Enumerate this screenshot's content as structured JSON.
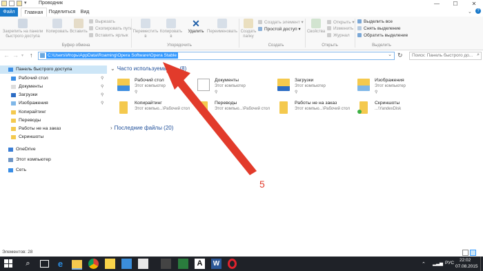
{
  "window": {
    "title": "Проводник"
  },
  "tabs": [
    "Файл",
    "Главная",
    "Поделиться",
    "Вид"
  ],
  "ribbon": {
    "clipboard": {
      "pin_label": "Закрепить на панели быстрого доступа",
      "copy_label": "Копировать",
      "paste_label": "Вставить",
      "cut": "Вырезать",
      "copy_path": "Скопировать путь",
      "paste_shortcut": "Вставить ярлык",
      "group_label": "Буфер обмена"
    },
    "organize": {
      "move_label": "Переместить в",
      "copy_to_label": "Копировать в",
      "delete_label": "Удалить",
      "rename_label": "Переименовать",
      "group_label": "Упорядочить"
    },
    "create": {
      "new_folder_label": "Создать папку",
      "new_item": "Создать элемент",
      "easy_access": "Простой доступ",
      "group_label": "Создать"
    },
    "open": {
      "properties_label": "Свойства",
      "open": "Открыть",
      "edit": "Изменить",
      "history": "Журнал",
      "group_label": "Открыть"
    },
    "select": {
      "select_all": "Выделить все",
      "select_none": "Снять выделение",
      "invert": "Обратить выделение",
      "group_label": "Выделить"
    }
  },
  "address": {
    "path": "C:\\Users\\Игорь\\AppData\\Roaming\\Opera Software\\Opera Stable",
    "search_placeholder": "Поиск: Панель быстрого до..."
  },
  "sidebar": {
    "items": [
      {
        "label": "Панель быстрого доступа",
        "pinned": false
      },
      {
        "label": "Рабочий стол",
        "pinned": true
      },
      {
        "label": "Документы",
        "pinned": true
      },
      {
        "label": "Загрузки",
        "pinned": true
      },
      {
        "label": "Изображения",
        "pinned": true
      },
      {
        "label": "Копирайтинг",
        "pinned": false
      },
      {
        "label": "Переводы",
        "pinned": false
      },
      {
        "label": "Работы не на заказ",
        "pinned": false
      },
      {
        "label": "Скриншоты",
        "pinned": false
      },
      {
        "label": "OneDrive",
        "pinned": false
      },
      {
        "label": "Этот компьютер",
        "pinned": false
      },
      {
        "label": "Сеть",
        "pinned": false
      }
    ]
  },
  "content": {
    "frequent_header": "Часто используемые п...(8)",
    "recent_header": "Последние файлы (20)",
    "tiles": [
      {
        "name": "Рабочий стол",
        "sub": "Этот компьютер"
      },
      {
        "name": "Документы",
        "sub": "Этот компьютер"
      },
      {
        "name": "Загрузки",
        "sub": "Этот компьютер"
      },
      {
        "name": "Изображения",
        "sub": "Этот компьютер"
      },
      {
        "name": "Копирайтинг",
        "sub": "Этот компью...\\Рабочий стол"
      },
      {
        "name": "Переводы",
        "sub": "Этот компью...\\Рабочий стол"
      },
      {
        "name": "Работы не на заказ",
        "sub": "Этот компью...\\Рабочий стол"
      },
      {
        "name": "Скриншоты",
        "sub": "...\\YandexDisk"
      }
    ]
  },
  "status": {
    "items_text": "Элементов: 28"
  },
  "taskbar": {
    "lang": "РУС",
    "time": "22:02",
    "date": "07.08.2015"
  },
  "annotation": {
    "number": "5",
    "color": "#e23b2b"
  }
}
